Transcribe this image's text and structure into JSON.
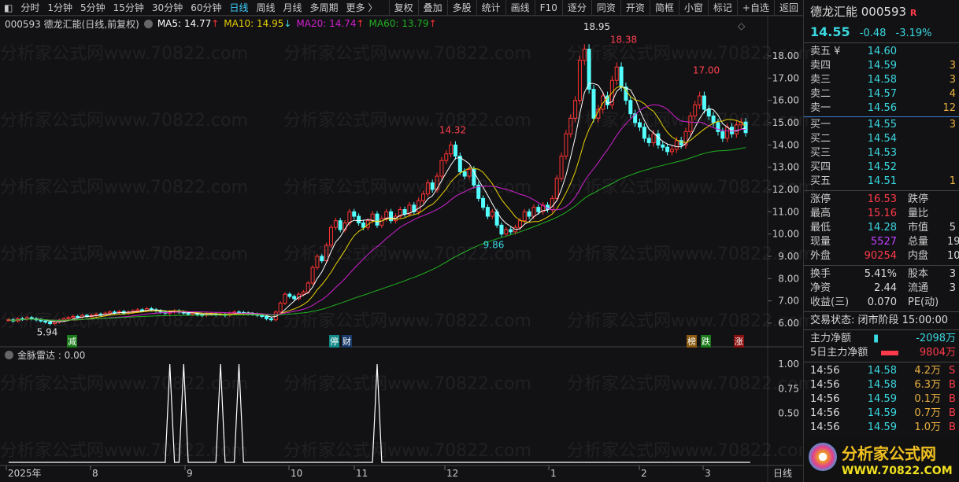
{
  "toolbar": {
    "left": [
      "分时",
      "1分钟",
      "5分钟",
      "15分钟",
      "30分钟",
      "60分钟",
      "日线",
      "周线",
      "月线",
      "多周期",
      "更多 〉"
    ],
    "active": "日线",
    "right": [
      "复权",
      "叠加",
      "多股",
      "统计",
      "画线",
      "F10",
      "逐分",
      "同资",
      "开资",
      "简框",
      "小窗",
      "标记",
      "+自选",
      "返回"
    ]
  },
  "info": {
    "title": "000593 德龙汇能(日线,前复权)",
    "ma5": "MA5: 14.77",
    "ma10": "MA10: 14.95",
    "ma20": "MA20: 14.74",
    "ma60": "MA60: 13.79",
    "ma5_dir": "↑",
    "ma10_dir": "↓",
    "ma20_dir": "↑",
    "ma60_dir": "↑"
  },
  "colors": {
    "up": "#ff3232",
    "down": "#54ffff",
    "ma5": "#ffffff",
    "ma10": "#e8d000",
    "ma20": "#d020d0",
    "ma60": "#20b020",
    "label": "#ff4050"
  },
  "watermark": "分析家公式网www.70822.com",
  "markers": [
    {
      "text": "减",
      "bg": "#1a7a1a"
    },
    {
      "text": "停",
      "bg": "#138a8a"
    },
    {
      "text": "财",
      "bg": "#1a3a6a"
    },
    {
      "text": "榜",
      "bg": "#8a5a10"
    },
    {
      "text": "跌",
      "bg": "#1a7a1a"
    },
    {
      "text": "涨",
      "bg": "#8a1010"
    }
  ],
  "indicator": {
    "label": "金脉雷达 : 0.00"
  },
  "chart_data": [
    {
      "type": "candlestick",
      "y_ticks": [
        "18.00",
        "17.00",
        "16.00",
        "15.00",
        "14.00",
        "13.00",
        "12.00",
        "11.00",
        "10.00",
        "9.00",
        "8.00",
        "7.00",
        "6.00"
      ],
      "ylim": [
        6,
        18
      ],
      "x_ticks": [
        "2025年",
        "8",
        "9",
        "10",
        "11",
        "12",
        "1",
        "2",
        "3"
      ],
      "period_label": "日线",
      "closes": [
        6.15,
        6.1,
        6.2,
        6.18,
        6.25,
        6.2,
        6.15,
        6.1,
        6.05,
        5.98,
        6.05,
        6.12,
        6.2,
        6.25,
        6.3,
        6.28,
        6.35,
        6.3,
        6.35,
        6.4,
        6.38,
        6.45,
        6.5,
        6.48,
        6.52,
        6.45,
        6.5,
        6.55,
        6.6,
        6.58,
        6.65,
        6.6,
        6.55,
        6.5,
        6.45,
        6.5,
        6.55,
        6.5,
        6.45,
        6.4,
        6.45,
        6.38,
        6.35,
        6.4,
        6.42,
        6.38,
        6.4,
        6.35,
        6.45,
        6.5,
        6.48,
        6.45,
        6.42,
        6.4,
        6.35,
        6.3,
        6.2,
        6.15,
        6.5,
        6.9,
        7.3,
        7.2,
        7.1,
        7.3,
        7.4,
        7.8,
        8.5,
        9.0,
        8.8,
        9.5,
        10.3,
        10.6,
        10.2,
        10.5,
        11.0,
        10.8,
        10.5,
        10.3,
        10.6,
        10.9,
        10.4,
        10.7,
        11.0,
        10.6,
        10.8,
        11.1,
        10.9,
        11.3,
        11.0,
        11.5,
        11.8,
        12.3,
        12.0,
        12.6,
        13.3,
        13.6,
        14.0,
        13.5,
        12.8,
        12.6,
        12.9,
        12.2,
        11.6,
        11.2,
        10.8,
        11.0,
        10.4,
        10.0,
        10.2,
        10.1,
        10.3,
        10.6,
        11.0,
        10.8,
        11.2,
        11.0,
        11.3,
        11.1,
        11.6,
        12.5,
        13.5,
        14.5,
        15.2,
        16.0,
        17.8,
        18.3,
        16.5,
        15.2,
        15.6,
        16.2,
        15.8,
        16.9,
        17.5,
        16.6,
        16.0,
        15.4,
        15.0,
        14.8,
        14.3,
        14.1,
        14.5,
        14.0,
        13.9,
        13.7,
        13.8,
        14.2,
        14.0,
        14.6,
        15.3,
        15.8,
        16.2,
        15.6,
        15.3,
        15.0,
        14.6,
        14.3,
        14.8,
        14.5,
        14.9,
        15.03,
        14.55
      ],
      "annotations": [
        {
          "text": "5.94",
          "price": 5.94,
          "color": "#dddddd"
        },
        {
          "text": "14.32",
          "price": 14.32,
          "color": "#ff4050"
        },
        {
          "text": "9.86",
          "price": 9.86,
          "color": "#3ad8e0"
        },
        {
          "text": "18.95",
          "price": 18.95,
          "color": "#dddddd"
        },
        {
          "text": "18.38",
          "price": 18.38,
          "color": "#ff4050"
        },
        {
          "text": "17.00",
          "price": 17.0,
          "color": "#ff4050"
        }
      ]
    },
    {
      "type": "line",
      "name": "金脉雷达",
      "y_ticks": [
        "1.00",
        "0.75",
        "0.50"
      ],
      "ylim": [
        0,
        1
      ],
      "values": [
        0,
        0,
        0,
        0,
        0,
        0,
        0,
        0,
        0,
        0,
        0,
        0,
        0,
        0,
        0,
        0,
        0,
        0,
        0,
        0,
        0,
        0,
        0,
        0,
        0,
        0,
        0,
        0,
        0,
        0,
        0,
        0,
        0,
        0,
        0,
        1,
        0,
        0,
        1,
        0,
        0,
        0,
        0,
        0,
        0,
        0,
        1,
        0,
        0,
        0,
        1,
        0,
        0,
        0,
        0,
        0,
        0,
        0,
        0,
        0,
        0,
        0,
        0,
        0,
        0,
        0,
        0,
        0,
        0,
        0,
        0,
        0,
        0,
        0,
        0,
        0,
        0,
        0,
        0,
        0,
        1,
        0,
        0,
        0,
        0,
        0,
        0,
        0,
        0,
        0,
        0,
        0,
        0,
        0,
        0,
        0,
        0,
        0,
        0,
        0,
        0,
        0,
        0,
        0,
        0,
        0,
        0,
        0,
        0,
        0,
        0,
        0,
        0,
        0,
        0,
        0,
        0,
        0,
        0,
        0,
        0,
        0,
        0,
        0,
        0,
        0,
        0,
        0,
        0,
        0,
        0,
        0,
        0,
        0,
        0,
        0,
        0,
        0,
        0,
        0,
        0,
        0,
        0,
        0,
        0,
        0,
        0,
        0,
        0,
        0,
        0,
        0,
        0,
        0,
        0,
        0,
        0,
        0,
        0,
        0,
        0,
        0
      ]
    }
  ],
  "quote": {
    "name": "德龙汇能 000593",
    "r": "R",
    "price": "14.55",
    "change": "-0.48",
    "pct": "-3.19%",
    "asks": [
      {
        "l": "卖五 ¥",
        "p": "14.60",
        "v": ""
      },
      {
        "l": "卖四",
        "p": "14.59",
        "v": "3"
      },
      {
        "l": "卖三",
        "p": "14.58",
        "v": "3"
      },
      {
        "l": "卖二",
        "p": "14.57",
        "v": "4"
      },
      {
        "l": "卖一",
        "p": "14.56",
        "v": "12"
      }
    ],
    "bids": [
      {
        "l": "买一",
        "p": "14.55",
        "v": "3"
      },
      {
        "l": "买二",
        "p": "14.54",
        "v": ""
      },
      {
        "l": "买三",
        "p": "14.53",
        "v": ""
      },
      {
        "l": "买四",
        "p": "14.52",
        "v": ""
      },
      {
        "l": "买五",
        "p": "14.51",
        "v": "1"
      }
    ],
    "stats1": [
      {
        "a": "涨停",
        "b": "16.53",
        "bc": "cr",
        "c": "跌停",
        "d": ""
      },
      {
        "a": "最高",
        "b": "15.16",
        "bc": "cr",
        "c": "量比",
        "d": ""
      },
      {
        "a": "最低",
        "b": "14.28",
        "bc": "cy",
        "c": "市值",
        "d": "5"
      },
      {
        "a": "现量",
        "b": "5527",
        "bc": "cm",
        "c": "总量",
        "d": "19"
      },
      {
        "a": "外盘",
        "b": "90254",
        "bc": "cr",
        "c": "内盘",
        "d": "10"
      }
    ],
    "stats2": [
      {
        "a": "换手",
        "b": "5.41%",
        "bc": "cw",
        "c": "股本",
        "d": "3"
      },
      {
        "a": "净资",
        "b": "2.44",
        "bc": "cw",
        "c": "流通",
        "d": "3"
      },
      {
        "a": "收益(三)",
        "b": "0.070",
        "bc": "cw",
        "c": "PE(动)",
        "d": ""
      }
    ],
    "status": "交易状态: 闭市阶段 15:00:00",
    "main_net": {
      "label": "主力净额",
      "value": "-2098万"
    },
    "main_net5": {
      "label": "5日主力净额",
      "value": "9804万"
    },
    "ticks": [
      {
        "t": "14:56",
        "p": "14.58",
        "v": "4.2万",
        "s": "S"
      },
      {
        "t": "14:56",
        "p": "14.58",
        "v": "6.3万",
        "s": "B"
      },
      {
        "t": "14:56",
        "p": "14.59",
        "v": "0.1万",
        "s": "B"
      },
      {
        "t": "14:56",
        "p": "14.59",
        "v": "0.7万",
        "s": "B"
      },
      {
        "t": "14:56",
        "p": "14.59",
        "v": "1.0万",
        "s": "B"
      }
    ],
    "logo": {
      "name": "分析家公式网",
      "url": "WWW.70822.COM"
    }
  }
}
